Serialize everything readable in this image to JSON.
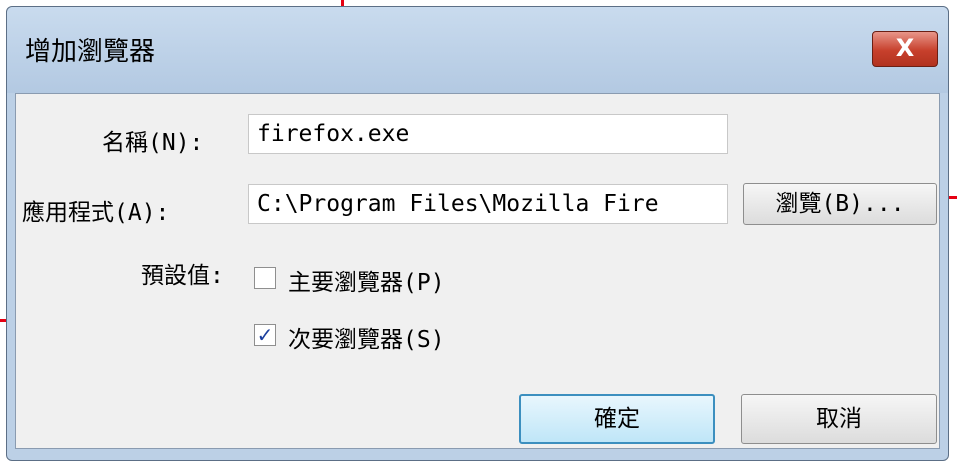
{
  "dialog": {
    "title": "增加瀏覽器",
    "close_label": "X"
  },
  "form": {
    "name_label": "名稱(N):",
    "name_value": "firefox.exe",
    "app_label": "應用程式(A):",
    "app_value": "C:\\Program Files\\Mozilla Fire",
    "browse_label": "瀏覽(B)...",
    "default_label": "預設值:",
    "primary_label": "主要瀏覽器(P)",
    "primary_checked": false,
    "secondary_label": "次要瀏覽器(S)",
    "secondary_checked": true,
    "check_mark": "✓"
  },
  "buttons": {
    "ok_label": "確定",
    "cancel_label": "取消"
  },
  "colors": {
    "callout": "#e60012",
    "title_bar": "#bcd0e6",
    "close_button": "#c7402c",
    "default_button_border": "#3c8fbf"
  }
}
